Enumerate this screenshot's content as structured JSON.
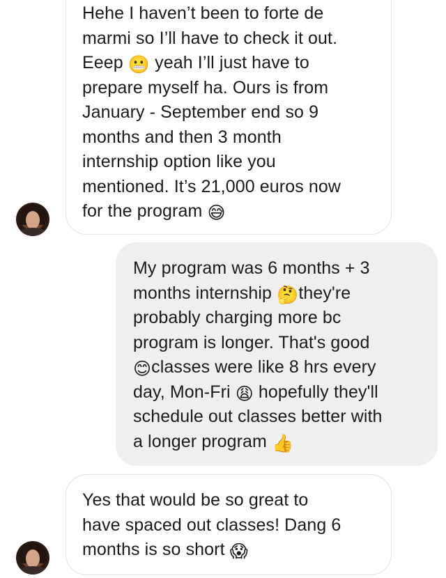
{
  "messages": [
    {
      "direction": "received",
      "lines": [
        "Hehe I haven’t been to forte de",
        "marmi so I’ll have to check it out.",
        [
          "Eeep ",
          "grimacing-face-emoji",
          " yeah I’ll just have to"
        ],
        "prepare myself ha. Ours is from",
        "January - September end so 9",
        "months and then 3 month",
        "internship option like you",
        "mentioned. It’s 21,000 euros now",
        [
          "for the program ",
          "grinning-face-with-sweat-emoji",
          ""
        ]
      ]
    },
    {
      "direction": "sent",
      "lines": [
        "My program was 6 months + 3",
        [
          "months internship ",
          "thinking-face-emoji",
          "they're"
        ],
        "probably charging more bc",
        "program is longer. That's good",
        [
          "",
          "smiling-face-with-smiling-eyes-emoji",
          "classes were like 8 hrs every"
        ],
        [
          "day, Mon-Fri ",
          "weary-face-emoji",
          " hopefully they'll"
        ],
        "schedule out classes better with",
        [
          "a longer program ",
          "thumbs-up-emoji",
          ""
        ]
      ]
    },
    {
      "direction": "received",
      "lines": [
        "Yes that would be so great to",
        "have spaced out classes! Dang 6",
        [
          "months is so short ",
          "face-screaming-in-fear-emoji",
          ""
        ]
      ]
    }
  ],
  "emoji_glyphs": {
    "grimacing-face-emoji": "😬",
    "grinning-face-with-sweat-emoji": "😅",
    "thinking-face-emoji": "🤔",
    "smiling-face-with-smiling-eyes-emoji": "😊",
    "weary-face-emoji": "😩",
    "thumbs-up-emoji": "👍",
    "face-screaming-in-fear-emoji": "😱"
  },
  "colors": {
    "received_bubble_bg": "#ffffff",
    "received_bubble_border": "#e3e3e3",
    "sent_bubble_bg": "#efefef",
    "text": "#1a1a1a"
  }
}
